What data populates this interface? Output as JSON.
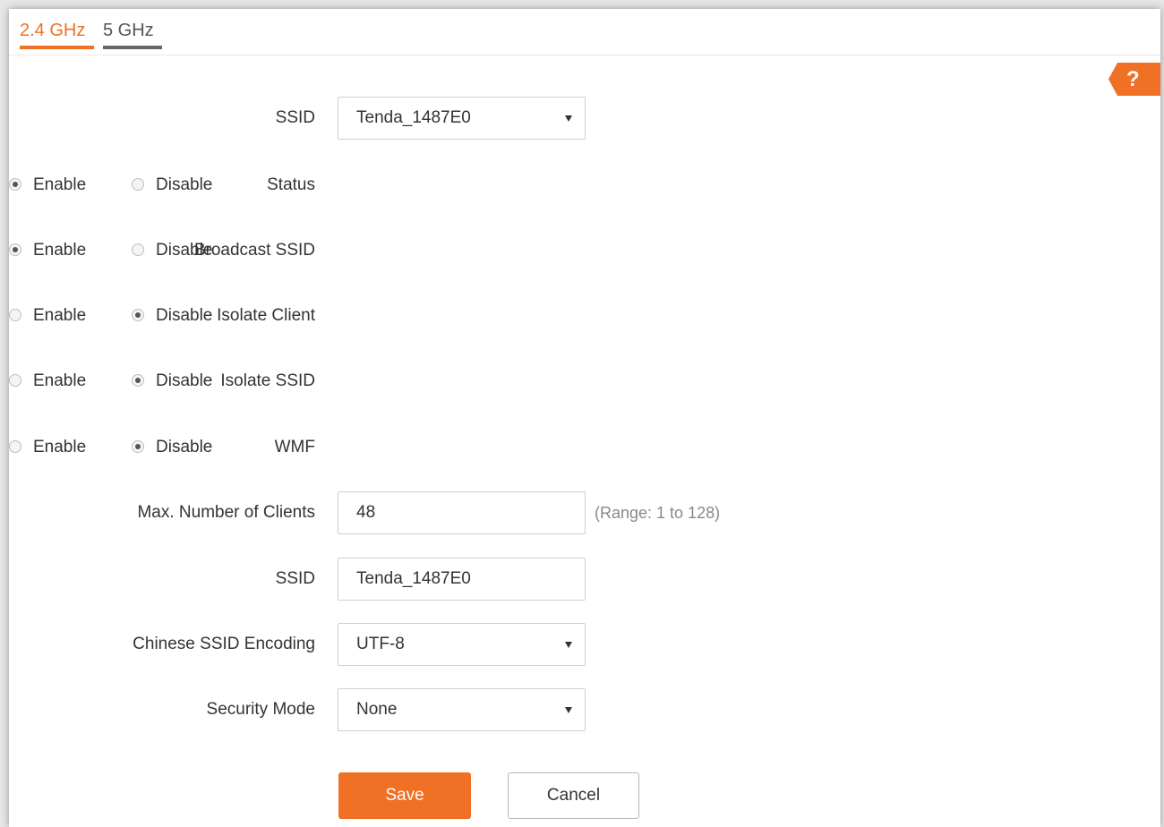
{
  "tabs": [
    {
      "label": "2.4 GHz",
      "active": true
    },
    {
      "label": "5 GHz",
      "active": false
    }
  ],
  "help_icon": {
    "glyph": "?",
    "icon": "help-icon"
  },
  "fields": {
    "ssid_select": {
      "label": "SSID",
      "value": "Tenda_1487E0"
    },
    "status": {
      "label": "Status",
      "options": [
        "Enable",
        "Disable"
      ],
      "selected": "Enable"
    },
    "broadcast_ssid": {
      "label": "Broadcast SSID",
      "options": [
        "Enable",
        "Disable"
      ],
      "selected": "Enable"
    },
    "isolate_client": {
      "label": "Isolate Client",
      "options": [
        "Enable",
        "Disable"
      ],
      "selected": "Disable"
    },
    "isolate_ssid": {
      "label": "Isolate SSID",
      "options": [
        "Enable",
        "Disable"
      ],
      "selected": "Disable"
    },
    "wmf": {
      "label": "WMF",
      "options": [
        "Enable",
        "Disable"
      ],
      "selected": "Disable"
    },
    "max_clients": {
      "label": "Max. Number of Clients",
      "value": "48",
      "hint": "(Range: 1 to 128)"
    },
    "ssid_name": {
      "label": "SSID",
      "value": "Tenda_1487E0"
    },
    "chinese_encoding": {
      "label": "Chinese SSID Encoding",
      "value": "UTF-8"
    },
    "security_mode": {
      "label": "Security Mode",
      "value": "None"
    }
  },
  "buttons": {
    "save": "Save",
    "cancel": "Cancel"
  },
  "colors": {
    "accent": "#f07025",
    "text": "#333333",
    "hint": "#888888"
  }
}
